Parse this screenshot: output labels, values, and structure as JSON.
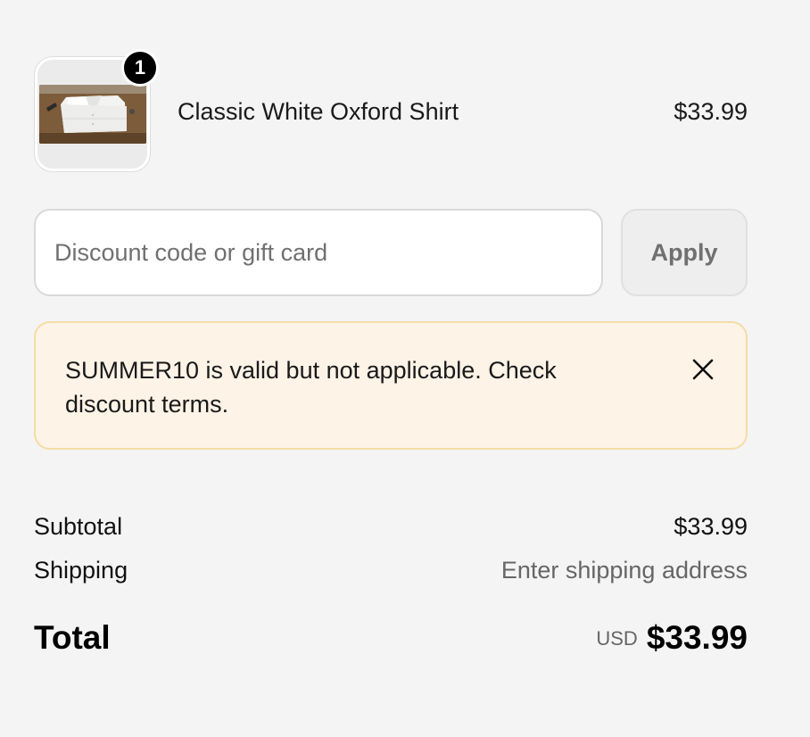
{
  "line_item": {
    "quantity": "1",
    "name": "Classic White Oxford Shirt",
    "price": "$33.99",
    "image_icon": "shirt-photo"
  },
  "discount": {
    "placeholder": "Discount code or gift card",
    "value": "",
    "apply_label": "Apply"
  },
  "notice": {
    "message": "SUMMER10 is valid but not applicable. Check discount terms.",
    "close_icon": "close-icon",
    "background_color": "#fdf3e7",
    "border_color": "#f4dca6"
  },
  "totals": {
    "subtotal_label": "Subtotal",
    "subtotal_value": "$33.99",
    "shipping_label": "Shipping",
    "shipping_value": "Enter shipping address",
    "total_label": "Total",
    "currency": "USD",
    "total_value": "$33.99"
  }
}
